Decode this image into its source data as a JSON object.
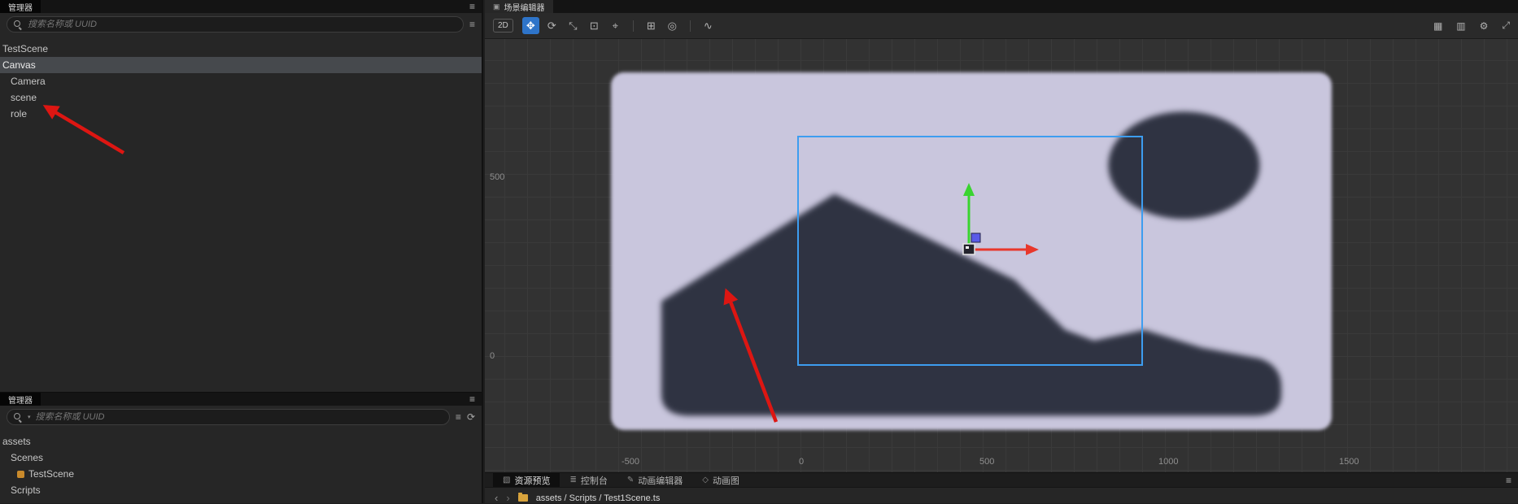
{
  "hierarchy_panel": {
    "tab_label": "管理器",
    "panel_menu_icon": "≡",
    "search": {
      "placeholder": "搜索名称或 UUID"
    },
    "list_menu_icon": "≡",
    "nodes": [
      {
        "label": "TestScene"
      },
      {
        "label": "Canvas",
        "state": "selected"
      },
      {
        "label": "Camera"
      },
      {
        "label": "scene"
      },
      {
        "label": "role"
      }
    ]
  },
  "assets_panel": {
    "tab_label": "管理器",
    "panel_menu_icon": "≡",
    "search": {
      "placeholder": "搜索名称或 UUID"
    },
    "list_menu_icon": "≡",
    "refresh_icon": "⟳",
    "dropdown_icon": "▾",
    "nodes": [
      {
        "label": "assets"
      },
      {
        "label": "Scenes"
      },
      {
        "label": "TestScene",
        "icon": "scene-file"
      },
      {
        "label": "Scripts"
      }
    ]
  },
  "scene_editor": {
    "tab_label": "场景编辑器",
    "tab_icon": "▣",
    "toolbar": {
      "mode_2d_label": "2D",
      "move_icon": "✥",
      "rotate_icon": "⟳",
      "scale_icon": "⤡",
      "rect_icon": "⊡",
      "anchor_icon": "⌖",
      "snap_icon": "⊞",
      "pivot_icon": "◎",
      "curve_icon": "∿",
      "grid_icon": "▦",
      "camera_icon": "▥",
      "gear_icon": "⚙",
      "fullscreen_icon": "⤢"
    },
    "ruler": {
      "left_labels": [
        "500",
        "0"
      ],
      "bottom_labels": [
        "-500",
        "0",
        "500",
        "1000",
        "1500"
      ]
    },
    "colors": {
      "selection": "#3d9df0",
      "gizmo_x_axis": "#e8372b",
      "gizmo_y_axis": "#39d430",
      "gizmo_handle": "#5a5ae8",
      "annotation_arrow": "#dd1612",
      "sprite_background": "#c9c6dd",
      "sprite_shape": "#2f3342"
    }
  },
  "bottom_bar": {
    "tabs": [
      {
        "label": "资源预览",
        "icon": "▧"
      },
      {
        "label": "控制台",
        "icon": "≣"
      },
      {
        "label": "动画编辑器",
        "icon": "✎"
      },
      {
        "label": "动画图",
        "icon": "◇"
      }
    ],
    "menu_icon": "≡",
    "breadcrumb": {
      "back_icon": "‹",
      "forward_icon": "›",
      "path": "assets / Scripts / Test1Scene.ts"
    }
  }
}
